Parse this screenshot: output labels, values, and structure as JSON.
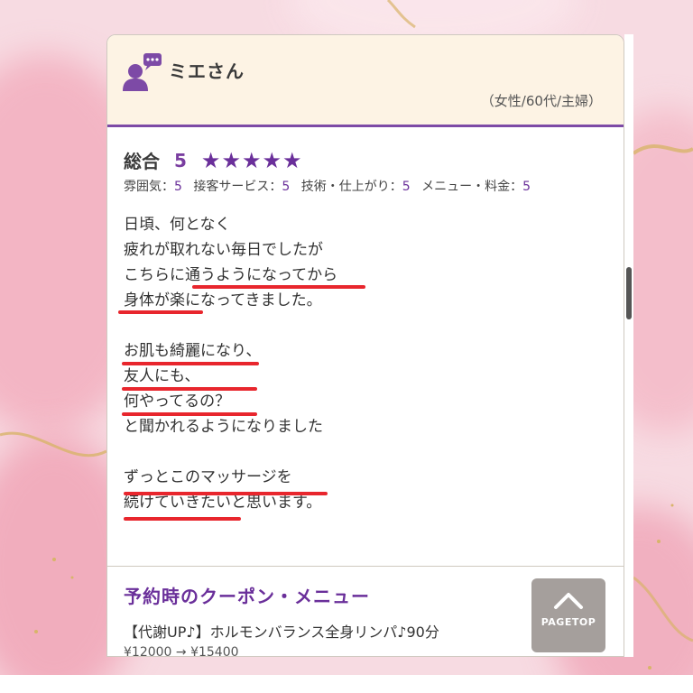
{
  "reviewer": {
    "name": "ミエさん",
    "meta": "（女性/60代/主婦）"
  },
  "rating": {
    "overall_label": "総合",
    "overall_score": "5",
    "stars": "★★★★★",
    "sub_ratings": [
      {
        "label": "雰囲気：",
        "value": "5"
      },
      {
        "label": "接客サービス：",
        "value": "5"
      },
      {
        "label": "技術・仕上がり：",
        "value": "5"
      },
      {
        "label": "メニュー・料金：",
        "value": "5"
      }
    ]
  },
  "body": {
    "lines": [
      "日頃、何となく",
      "疲れが取れない毎日でしたが",
      "こちらに通うようになってから",
      "身体が楽になってきました。",
      "",
      "お肌も綺麗になり、",
      "友人にも、",
      "何やってるの？",
      "と聞かれるようになりました",
      "",
      "ずっとこのマッサージを",
      "続けていきたいと思います。"
    ]
  },
  "coupon": {
    "title": "予約時のクーポン・メニュー",
    "item": "【代謝UP♪】ホルモンバランス全身リンパ♪90分",
    "price": "¥12000 → ¥15400"
  },
  "pagetop": {
    "label": "PAGETOP"
  },
  "colors": {
    "accent": "#6a2f9a",
    "underline": "#e8262d",
    "header_bg": "#fdf3e4",
    "pagetop_bg": "#a59f9c"
  }
}
